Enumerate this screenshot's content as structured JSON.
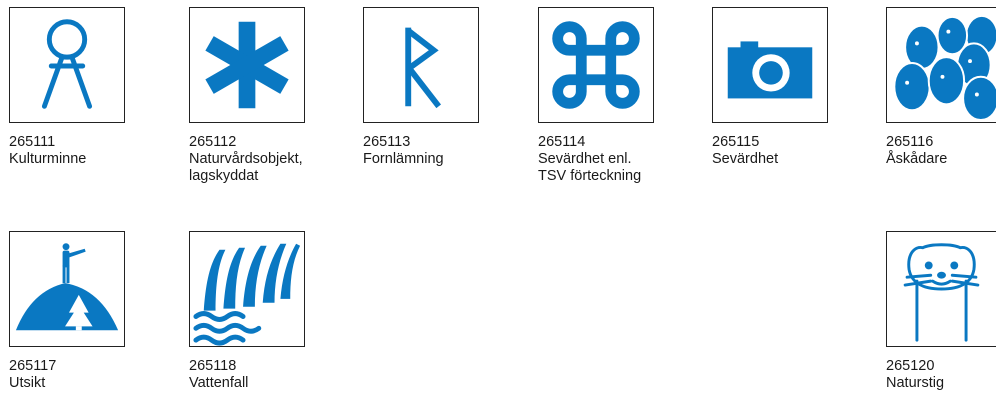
{
  "colors": {
    "symbol": "#0a78c2",
    "border": "#222222",
    "text": "#1a1a1a"
  },
  "signs": [
    {
      "code": "265111",
      "label_lines": [
        "Kulturminne"
      ],
      "icon": "kulturminne-icon"
    },
    {
      "code": "265112",
      "label_lines": [
        "Naturvårdsobjekt,",
        "lagskyddat"
      ],
      "icon": "snowflake-icon"
    },
    {
      "code": "265113",
      "label_lines": [
        "Fornlämning"
      ],
      "icon": "rune-r-icon"
    },
    {
      "code": "265114",
      "label_lines": [
        "Sevärdhet enl.",
        "TSV förteckning"
      ],
      "icon": "command-symbol-icon"
    },
    {
      "code": "265115",
      "label_lines": [
        "Sevärdhet"
      ],
      "icon": "camera-icon"
    },
    {
      "code": "265116",
      "label_lines": [
        "Åskådare"
      ],
      "icon": "crowd-icon"
    },
    {
      "code": "265117",
      "label_lines": [
        "Utsikt"
      ],
      "icon": "viewpoint-icon"
    },
    {
      "code": "265118",
      "label_lines": [
        "Vattenfall"
      ],
      "icon": "waterfall-icon"
    },
    {
      "code": "265120",
      "label_lines": [
        "Naturstig"
      ],
      "icon": "stoat-icon"
    }
  ]
}
